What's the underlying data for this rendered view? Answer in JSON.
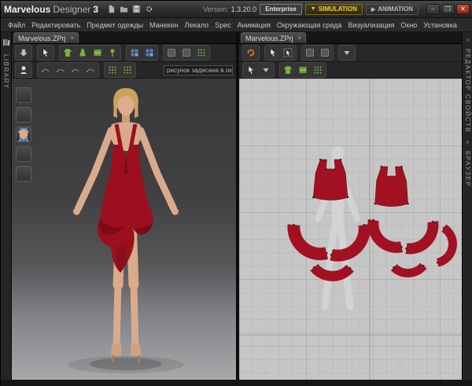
{
  "title_bar": {
    "brand_bold": "Marvelous",
    "brand_light": "Designer",
    "brand_num": "3",
    "version_label": "Version:",
    "version_value": "1.3.20.0",
    "enterprise_label": "Enterprise",
    "simulation_label": "SIMULATION",
    "animation_label": "ANIMATION",
    "window_controls": {
      "minimize": "–",
      "maximize": "❒",
      "close": "✕"
    }
  },
  "menu_items": [
    "Файл",
    "Редактировать",
    "Предмет одежды",
    "Манекен",
    "Лекало",
    "Spec",
    "Анимация",
    "Окружающая среда",
    "Визуализация",
    "Окно",
    "Установка"
  ],
  "tabs": {
    "left": "Marvelous.ZPrj",
    "right": "Marvelous.ZPrj",
    "close_glyph": "×"
  },
  "toolbar": {
    "pattern_field_text": "рисунок задисана в окне",
    "sim_caret": "▼",
    "anim_glyph": "▶"
  },
  "panels": {
    "library": "LIBRARY",
    "property_editor": "РЕДАКТОР СВОЙСТВ",
    "browser": "БРАУЗЕР",
    "collapse_glyph": "«"
  },
  "colors": {
    "accent_red": "#9c0f1e",
    "sim_yellow": "#f0cc3e",
    "tool_green": "#79b33c",
    "tool_blue": "#4a7fc1",
    "sync_orange": "#e07820",
    "skin": "#d9ab8b",
    "hair_blonde": "#c9a25d"
  },
  "toolbars": {
    "title_icons": [
      "new-doc",
      "open-folder",
      "save",
      "settings"
    ],
    "left_row1_g1": [
      "big-arrow-down"
    ],
    "left_row1_g2": [
      "pointer"
    ],
    "left_row1_g3": [
      "tshirt-green",
      "dress-green",
      "sew-green",
      "pin-green"
    ],
    "left_row1_g4": [
      "grid-blue",
      "grid-blue"
    ],
    "left_row1_g5": [
      "box",
      "box",
      "grid-dots"
    ],
    "left_row2_g1": [
      "avatar-head"
    ],
    "left_row2_g2": [
      "seam",
      "seam",
      "seam",
      "seam"
    ],
    "left_row2_g3": [
      "grid-dots",
      "grid-dots"
    ],
    "right_row1_g1": [
      "sync-orange"
    ],
    "right_row1_g2": [
      "pointer",
      "pointer-box"
    ],
    "right_row1_g3": [
      "box",
      "box"
    ],
    "right_row1_g4": [
      "caret-down"
    ],
    "right_row2_g1": [
      "pointer",
      "caret-down"
    ],
    "right_row2_g2": [
      "tshirt-green",
      "sew-green",
      "grid-dots"
    ],
    "thumb_items": [
      "shirt-white",
      "bust",
      "bust",
      "pants-blue",
      "head-tan"
    ],
    "library_icon": [
      "books"
    ]
  }
}
